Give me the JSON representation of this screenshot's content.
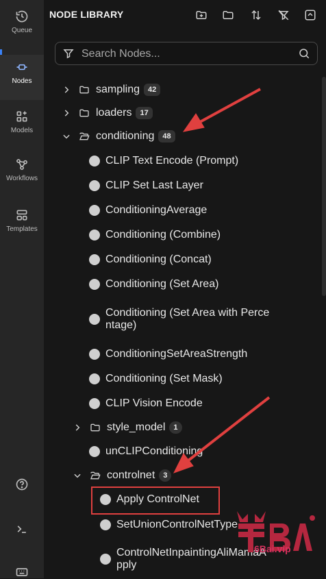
{
  "rail": {
    "items": [
      {
        "label": "Queue",
        "icon": "history-icon"
      },
      {
        "label": "Nodes",
        "icon": "nodes-icon"
      },
      {
        "label": "Models",
        "icon": "models-icon"
      },
      {
        "label": "Workflows",
        "icon": "workflows-icon"
      },
      {
        "label": "Templates",
        "icon": "templates-icon"
      }
    ],
    "active": "Nodes",
    "bottom": [
      "help-icon",
      "terminal-icon",
      "keyboard-icon"
    ]
  },
  "panel": {
    "title": "NODE LIBRARY",
    "toolbar": [
      "new-folder-icon",
      "folder-icon",
      "sort-icon",
      "filter-off-icon",
      "collapse-icon"
    ]
  },
  "search": {
    "placeholder": "Search Nodes..."
  },
  "tree": {
    "sampling": {
      "label": "sampling",
      "count": "42"
    },
    "loaders": {
      "label": "loaders",
      "count": "17"
    },
    "conditioning": {
      "label": "conditioning",
      "count": "48",
      "items": [
        "CLIP Text Encode (Prompt)",
        "CLIP Set Last Layer",
        "ConditioningAverage",
        "Conditioning (Combine)",
        "Conditioning (Concat)",
        "Conditioning (Set Area)",
        "Conditioning (Set Area with Perce",
        "ntage)",
        "ConditioningSetAreaStrength",
        "Conditioning (Set Mask)",
        "CLIP Vision Encode"
      ]
    },
    "style_model": {
      "label": "style_model",
      "count": "1"
    },
    "unclip": {
      "label": "unCLIPConditioning"
    },
    "controlnet": {
      "label": "controlnet",
      "count": "3",
      "items": [
        "Apply ControlNet",
        "SetUnionControlNetType",
        "ControlNetInpaintingAliMamaA",
        "pply"
      ]
    }
  },
  "watermark": {
    "site": "6Bai.vip"
  },
  "colors": {
    "accent": "#3b82f6",
    "annotation": "#e0403f",
    "watermark": "#d6315e"
  }
}
